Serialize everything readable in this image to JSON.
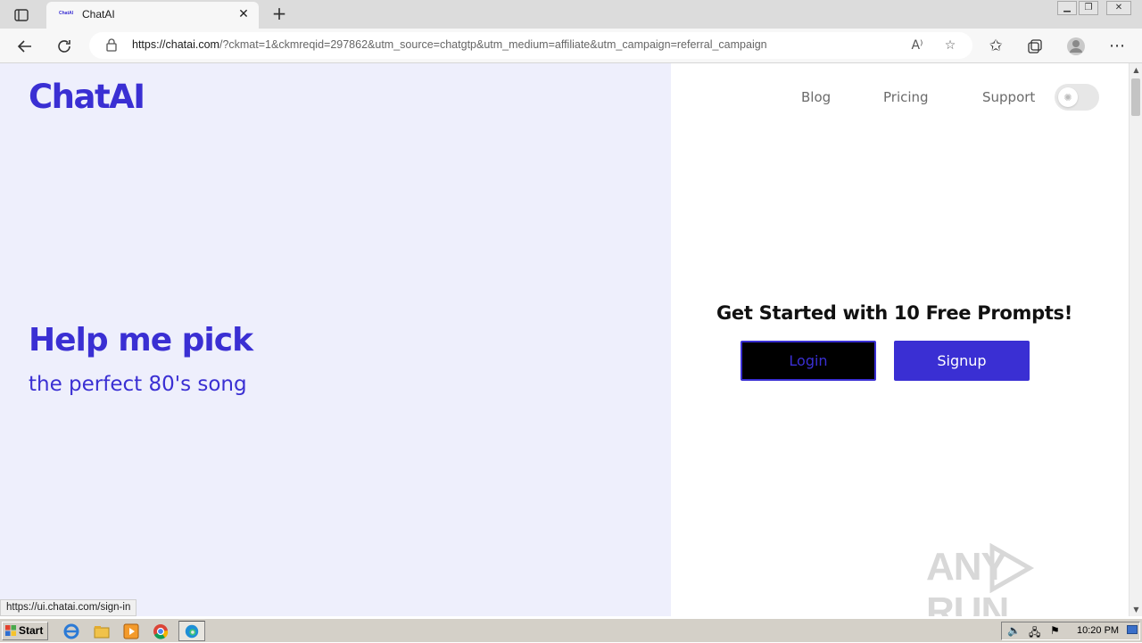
{
  "browser": {
    "tab_title": "ChatAI",
    "tab_favicon_text": "ChatAI",
    "url_host": "https://chatai.com",
    "url_rest": "/?ckmat=1&ckmreqid=297862&utm_source=chatgtp&utm_medium=affiliate&utm_campaign=referral_campaign",
    "status_link": "https://ui.chatai.com/sign-in"
  },
  "site": {
    "logo": "ChatAI",
    "nav": [
      {
        "label": "Blog"
      },
      {
        "label": "Pricing"
      },
      {
        "label": "Support"
      }
    ],
    "headline": "Help me pick",
    "subline": "the perfect 80's song",
    "cta_title": "Get Started with 10 Free Prompts!",
    "login_label": "Login",
    "signup_label": "Signup",
    "brand_color": "#3a2fd3",
    "left_panel_color": "#eeeffc"
  },
  "watermark": {
    "left": "ANY",
    "right": "RUN"
  },
  "taskbar": {
    "start_label": "Start",
    "clock": "10:20 PM"
  }
}
